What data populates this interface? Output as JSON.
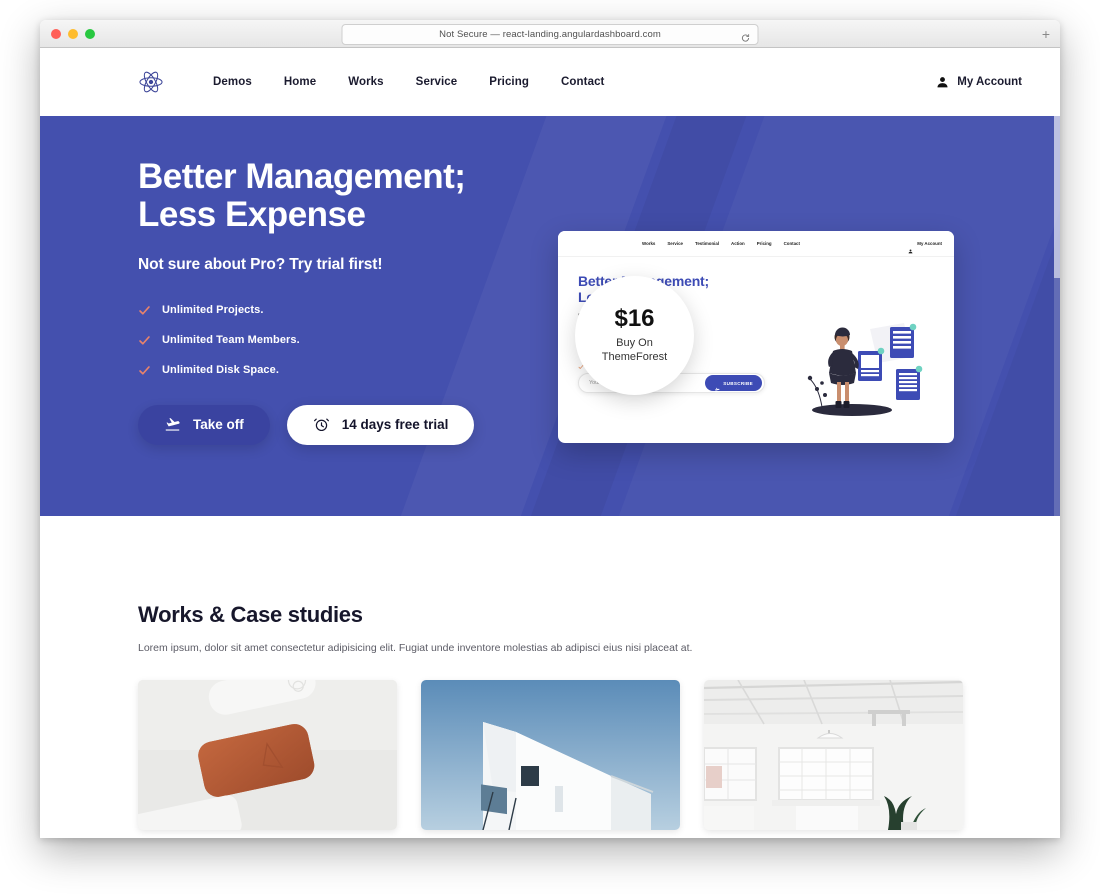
{
  "browser": {
    "url_text": "Not Secure — react-landing.angulardashboard.com",
    "reload_icon": "reload-icon",
    "new_tab_label": "+",
    "traffic_lights": [
      "close",
      "minimize",
      "zoom"
    ]
  },
  "site_nav": {
    "logo_icon": "atom-logo-icon",
    "links": [
      {
        "label": "Demos"
      },
      {
        "label": "Home"
      },
      {
        "label": "Works"
      },
      {
        "label": "Service"
      },
      {
        "label": "Pricing"
      },
      {
        "label": "Contact"
      }
    ],
    "account": {
      "icon": "person-icon",
      "label": "My Account"
    }
  },
  "hero": {
    "bg_color": "#4450ae",
    "heading_line1": "Better Management;",
    "heading_line2": "Less Expense",
    "subheading": "Not sure about Pro? Try trial first!",
    "check_color": "#e8836b",
    "features": [
      {
        "label": "Unlimited Projects."
      },
      {
        "label": "Unlimited Team Members."
      },
      {
        "label": "Unlimited Disk Space."
      }
    ],
    "buttons": [
      {
        "label": "Take off",
        "icon": "flight-takeoff-icon",
        "style": "primary"
      },
      {
        "label": "14 days free trial",
        "icon": "alarm-clock-icon",
        "style": "ghost"
      }
    ],
    "badge": {
      "price": "$16",
      "line1": "Buy On",
      "line2": "ThemeForest"
    },
    "preview": {
      "nav_links": [
        {
          "label": "Works"
        },
        {
          "label": "Service"
        },
        {
          "label": "Testimonial"
        },
        {
          "label": "Action"
        },
        {
          "label": "Pricing"
        },
        {
          "label": "Contact"
        }
      ],
      "account_label": "My Account",
      "account_icon": "person-icon",
      "heading_line1": "Better Management;",
      "heading_line2": "Less Expense",
      "subheading": "Dont wast money! Try free version first.",
      "features": [
        {
          "label": "Unlimited Projects."
        },
        {
          "label": "Unlimited Team Members."
        },
        {
          "label": "Unlimited Disk Space."
        }
      ],
      "email_placeholder": "Your email",
      "subscribe_label": "SUBSCRIBE",
      "subscribe_icon": "flight-takeoff-icon",
      "accent_color": "#3d4bb5",
      "illustration": "woman-with-documents-illustration"
    }
  },
  "works": {
    "title": "Works & Case studies",
    "description": "Lorem ipsum, dolor sit amet consectetur adipisicing elit. Fugiat unde inventore molestias ab adipisci eius nisi placeat at.",
    "cards": [
      {
        "name": "orange-soap-product-photo"
      },
      {
        "name": "white-modern-house-photo"
      },
      {
        "name": "white-loft-interior-photo"
      }
    ]
  }
}
